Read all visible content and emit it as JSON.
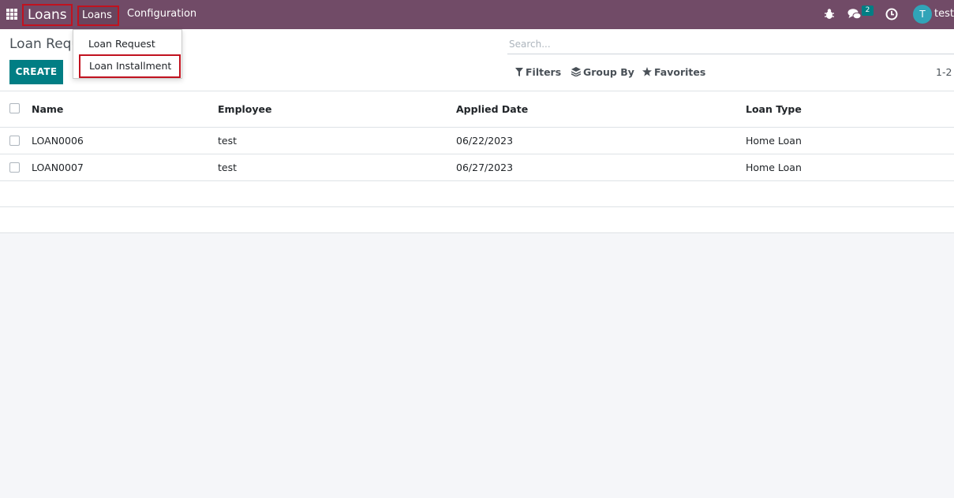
{
  "navbar": {
    "app_name": "Loans",
    "menu": [
      "Loans",
      "Configuration"
    ],
    "chat_count": "2",
    "user_initial": "T",
    "user_name": "test",
    "color": "#714b67",
    "icons": [
      "apps-grid-icon",
      "bug-icon",
      "chat-icon",
      "clock-icon"
    ]
  },
  "dropdown": {
    "items": [
      "Loan Request",
      "Loan Installment"
    ],
    "highlighted": "Loan Installment"
  },
  "control_panel": {
    "title": "Loan Requ",
    "create_label": "CREATE",
    "search_placeholder": "Search...",
    "filters_label": "Filters",
    "group_by_label": "Group By",
    "favorites_label": "Favorites",
    "pager": "1-2 /",
    "accent": "#017e84"
  },
  "list": {
    "columns": [
      "Name",
      "Employee",
      "Applied Date",
      "Loan Type"
    ],
    "rows": [
      {
        "name": "LOAN0006",
        "employee": "test",
        "applied_date": "06/22/2023",
        "loan_type": "Home Loan"
      },
      {
        "name": "LOAN0007",
        "employee": "test",
        "applied_date": "06/27/2023",
        "loan_type": "Home Loan"
      }
    ]
  }
}
